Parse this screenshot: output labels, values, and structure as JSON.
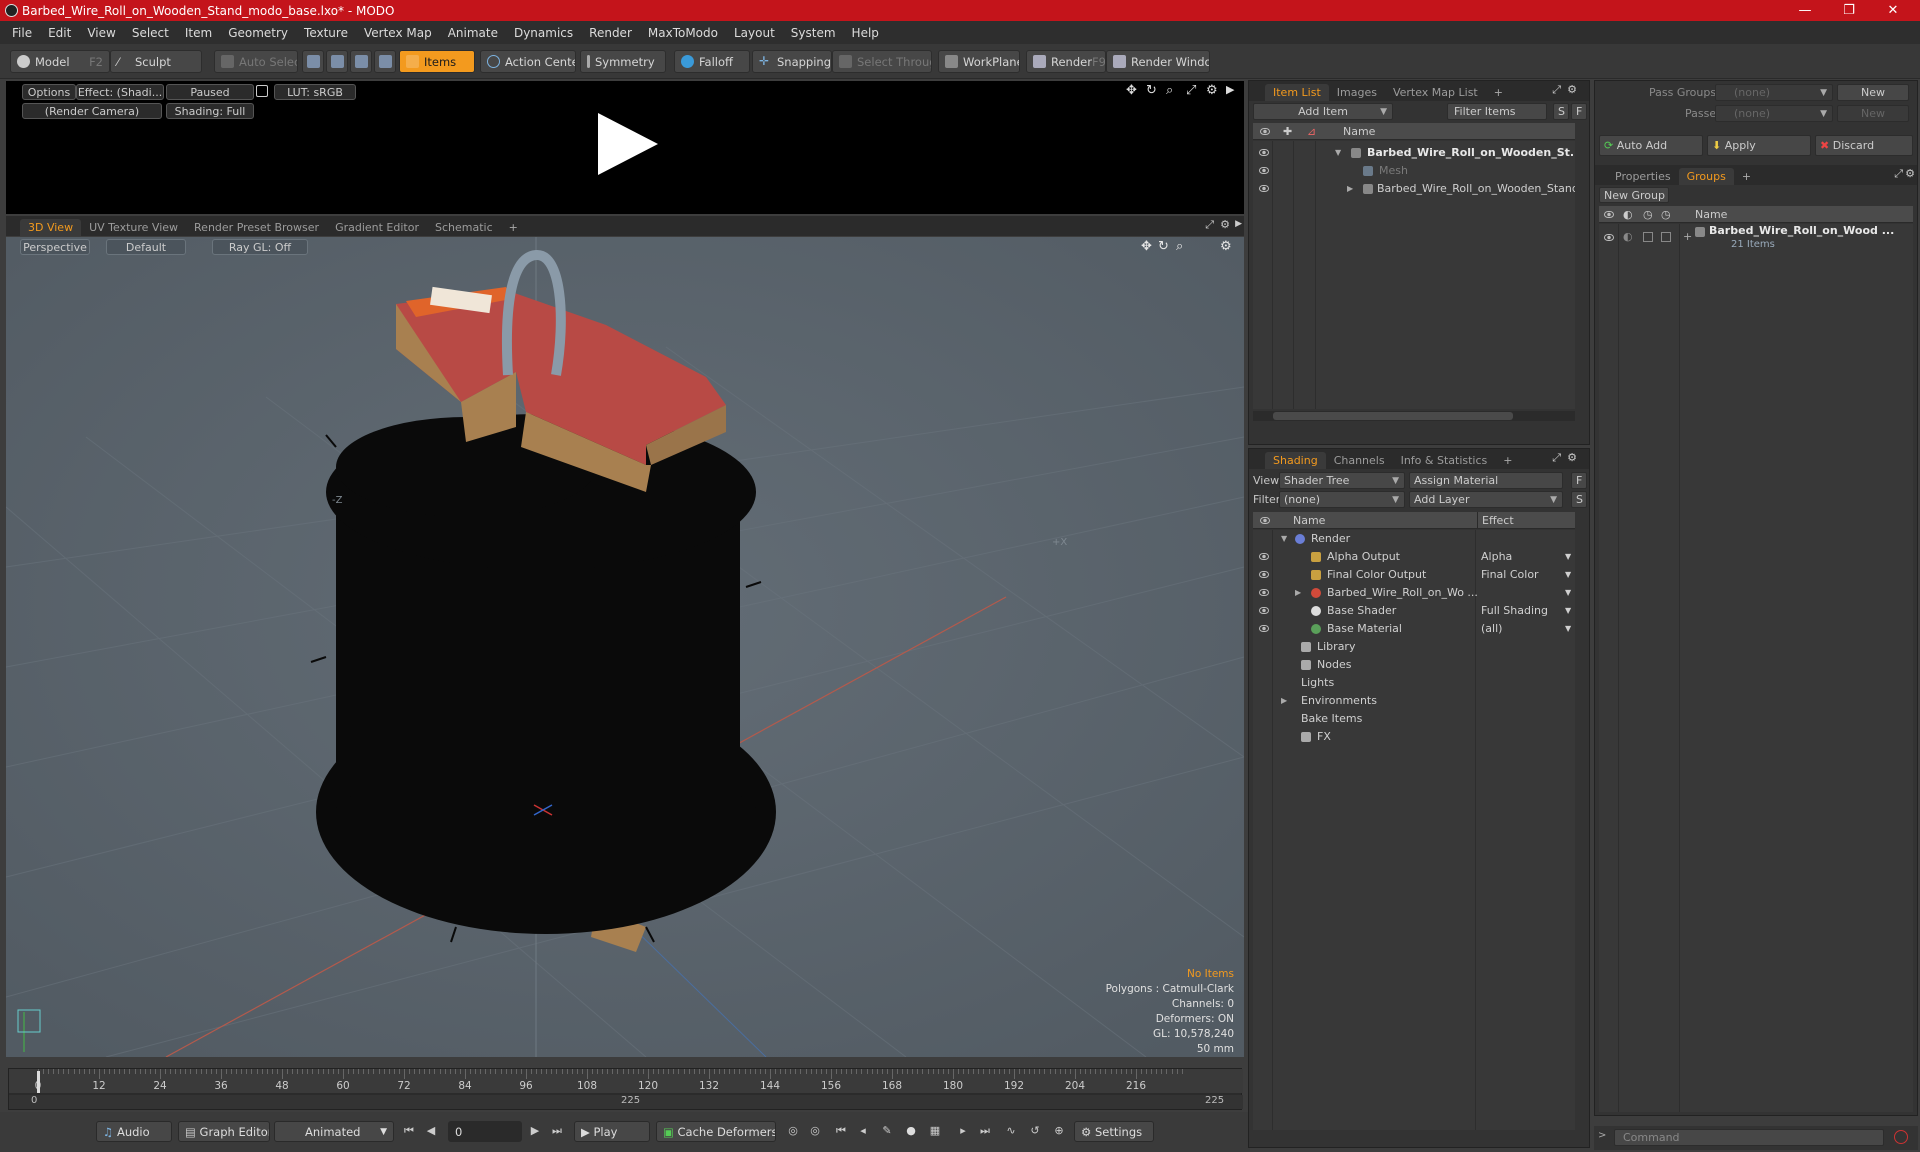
{
  "window": {
    "title": "Barbed_Wire_Roll_on_Wooden_Stand_modo_base.lxo* - MODO",
    "controls": [
      "—",
      "❐",
      "✕"
    ]
  },
  "menu": [
    "File",
    "Edit",
    "View",
    "Select",
    "Item",
    "Geometry",
    "Texture",
    "Vertex Map",
    "Animate",
    "Dynamics",
    "Render",
    "MaxToModo",
    "Layout",
    "System",
    "Help"
  ],
  "toolbar": {
    "model": "Model",
    "model_key": "F2",
    "sculpt": "Sculpt",
    "auto_select": "Auto Select",
    "items": "Items",
    "action_center": "Action Center",
    "symmetry": "Symmetry",
    "falloff": "Falloff",
    "snapping": "Snapping",
    "select_through": "Select Through",
    "workplane": "WorkPlane",
    "render": "Render",
    "render_key": "F9",
    "render_window": "Render Window"
  },
  "preview": {
    "options": "Options",
    "effect": "Effect: (Shadi...",
    "paused": "Paused",
    "lut": "LUT: sRGB",
    "camera": "(Render Camera)",
    "shading": "Shading: Full"
  },
  "viewport": {
    "tabs": [
      "3D View",
      "UV Texture View",
      "Render Preset Browser",
      "Gradient Editor",
      "Schematic",
      "+"
    ],
    "perspective": "Perspective",
    "default": "Default",
    "raygl": "Ray GL: Off",
    "axis_z": "-Z",
    "axis_x": "+X",
    "status": {
      "items": "No Items",
      "polygons": "Polygons : Catmull-Clark",
      "channels": "Channels: 0",
      "deformers": "Deformers: ON",
      "gl": "GL: 10,578,240",
      "focal": "50 mm"
    },
    "colors": {
      "bg": "#5a646d",
      "wire": "#0a0a0a",
      "wood": "#a88050",
      "paint": "#b84a45"
    }
  },
  "timeline": {
    "ticks": [
      "0",
      "12",
      "24",
      "36",
      "48",
      "60",
      "72",
      "84",
      "96",
      "108",
      "120",
      "132",
      "144",
      "156",
      "168",
      "180",
      "192",
      "204",
      "216"
    ],
    "start": "0",
    "mid": "225",
    "end": "225"
  },
  "bottombar": {
    "audio": "Audio",
    "graph_editor": "Graph Editor",
    "animated": "Animated",
    "frame": "0",
    "play": "Play",
    "cache_deformers": "Cache Deformers",
    "settings": "Settings"
  },
  "item_list": {
    "tabs": [
      "Item List",
      "Images",
      "Vertex Map List",
      "+"
    ],
    "add_item": "Add Item",
    "filter_items": "Filter Items",
    "s": "S",
    "f": "F",
    "col_name": "Name",
    "rows": [
      {
        "label": "Barbed_Wire_Roll_on_Wooden_St...",
        "bold": true
      },
      {
        "label": "Mesh",
        "dim": true
      },
      {
        "label": "Barbed_Wire_Roll_on_Wooden_Stand..."
      }
    ]
  },
  "shading": {
    "tabs": [
      "Shading",
      "Channels",
      "Info & Statistics",
      "+"
    ],
    "view_label": "View",
    "view_value": "Shader Tree",
    "assign_material": "Assign Material",
    "filter_label": "Filter",
    "filter_value": "(none)",
    "add_layer": "Add Layer",
    "f": "F",
    "s": "S",
    "col_name": "Name",
    "col_effect": "Effect",
    "rows": [
      {
        "label": "Render",
        "effect": ""
      },
      {
        "label": "Alpha Output",
        "effect": "Alpha"
      },
      {
        "label": "Final Color Output",
        "effect": "Final Color"
      },
      {
        "label": "Barbed_Wire_Roll_on_Wo ...",
        "effect": ""
      },
      {
        "label": "Base Shader",
        "effect": "Full Shading"
      },
      {
        "label": "Base Material",
        "effect": "(all)"
      },
      {
        "label": "Library",
        "effect": ""
      },
      {
        "label": "Nodes",
        "effect": ""
      },
      {
        "label": "Lights",
        "effect": ""
      },
      {
        "label": "Environments",
        "effect": ""
      },
      {
        "label": "Bake Items",
        "effect": ""
      },
      {
        "label": "FX",
        "effect": ""
      }
    ]
  },
  "groups": {
    "pass_groups": "Pass Groups",
    "pass_groups_value": "(none)",
    "new": "New",
    "passes": "Passes",
    "passes_value": "(none)",
    "new2": "New",
    "auto_add": "Auto Add",
    "apply": "Apply",
    "discard": "Discard",
    "tabs": [
      "Properties",
      "Groups",
      "+"
    ],
    "new_group": "New Group",
    "col_name": "Name",
    "item_name": "Barbed_Wire_Roll_on_Wood ...",
    "item_count": "21 Items"
  },
  "command": {
    "placeholder": "Command"
  },
  "accent": "#f39a1e"
}
